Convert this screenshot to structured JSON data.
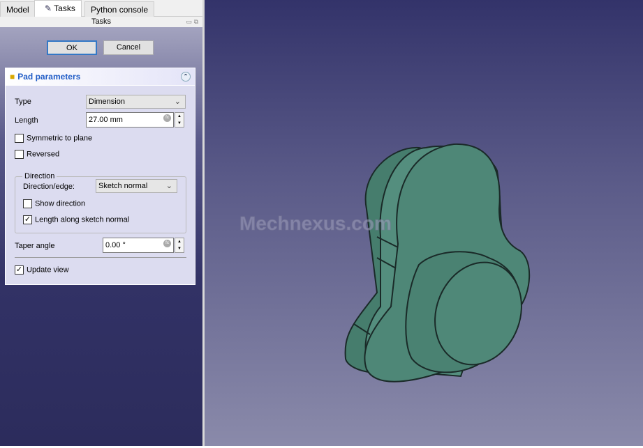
{
  "tabs": [
    {
      "label": "Model"
    },
    {
      "label": "Tasks"
    },
    {
      "label": "Python console"
    }
  ],
  "panel_title": "Tasks",
  "buttons": {
    "ok": "OK",
    "cancel": "Cancel"
  },
  "pad": {
    "title": "Pad parameters",
    "type_label": "Type",
    "type_value": "Dimension",
    "length_label": "Length",
    "length_value": "27.00 mm",
    "symmetric_label": "Symmetric to plane",
    "symmetric_checked": false,
    "reversed_label": "Reversed",
    "reversed_checked": false,
    "direction_group": "Direction",
    "direction_edge_label": "Direction/edge:",
    "direction_edge_value": "Sketch normal",
    "show_direction_label": "Show direction",
    "show_direction_checked": false,
    "length_along_label": "Length along sketch normal",
    "length_along_checked": true,
    "taper_label": "Taper angle",
    "taper_value": "0.00 °",
    "update_view_label": "Update view",
    "update_view_checked": true
  },
  "check_mark": "✓",
  "watermark": "Mechnexus.com",
  "colors": {
    "accent": "#215dc6",
    "model": "#4e8777",
    "edge": "#1a2a28"
  }
}
